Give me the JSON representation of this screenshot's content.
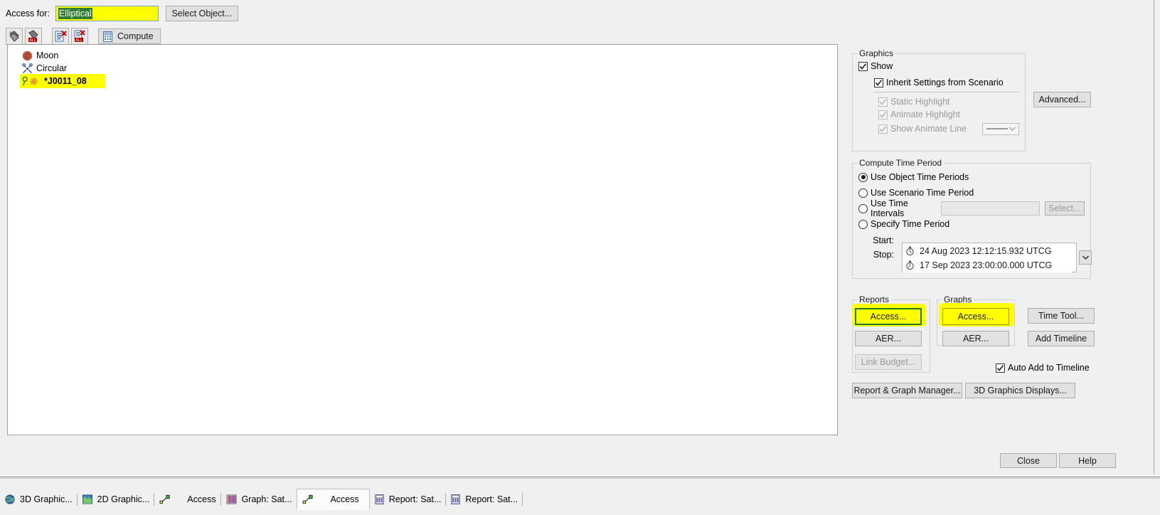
{
  "header": {
    "access_for_label": "Access for:",
    "access_for_value": "Elliptical",
    "select_object_button": "Select Object..."
  },
  "toolbar": {
    "buttons": [
      {
        "name": "remove-object",
        "label": ""
      },
      {
        "name": "remove-all-objects",
        "label": ""
      },
      {
        "name": "clear-report",
        "label": ""
      },
      {
        "name": "clear-all-reports",
        "label": ""
      }
    ],
    "compute_label": "Compute"
  },
  "object_list": {
    "items": [
      {
        "label": "Moon",
        "icon": "moon-icon",
        "selected": false
      },
      {
        "label": "Circular",
        "icon": "satellite-icon",
        "selected": false
      },
      {
        "label": "*J0011_08",
        "icon": "star-target-icon",
        "selected": true
      }
    ]
  },
  "graphics": {
    "legend": "Graphics",
    "show": {
      "label": "Show",
      "checked": true,
      "enabled": true
    },
    "inherit": {
      "label": "Inherit Settings from Scenario",
      "checked": true,
      "enabled": true
    },
    "static_highlight": {
      "label": "Static Highlight",
      "checked": true,
      "enabled": false
    },
    "animate_highlight": {
      "label": "Animate Highlight",
      "checked": true,
      "enabled": false
    },
    "show_animate_line": {
      "label": "Show Animate Line",
      "checked": true,
      "enabled": false
    },
    "advanced_button": "Advanced..."
  },
  "compute_time_period": {
    "legend": "Compute Time Period",
    "options": [
      {
        "label": "Use Object Time Periods",
        "selected": true
      },
      {
        "label": "Use Scenario Time Period",
        "selected": false
      },
      {
        "label": "Use Time Intervals",
        "selected": false
      },
      {
        "label": "Specify Time Period",
        "selected": false
      }
    ],
    "time_intervals_value": "",
    "select_button": "Select...",
    "start_label": "Start:",
    "start_value": "24 Aug 2023 12:12:15.932 UTCG",
    "stop_label": "Stop:",
    "stop_value": "17 Sep 2023 23:00:00.000 UTCG"
  },
  "reports": {
    "legend": "Reports",
    "access_button": "Access...",
    "aer_button": "AER...",
    "link_budget_button": "Link Budget..."
  },
  "graphs": {
    "legend": "Graphs",
    "access_button": "Access...",
    "aer_button": "AER..."
  },
  "tools": {
    "time_tool_button": "Time Tool...",
    "add_timeline_button": "Add Timeline",
    "auto_add_label": "Auto Add to Timeline",
    "auto_add_checked": true,
    "report_graph_manager_button": "Report & Graph Manager...",
    "graphics_displays_button": "3D Graphics Displays..."
  },
  "footer": {
    "close_button": "Close",
    "help_button": "Help"
  },
  "taskbar": {
    "items": [
      {
        "label": "3D Graphic...",
        "icon": "globe-icon",
        "active": false
      },
      {
        "label": "2D Graphic...",
        "icon": "map-icon",
        "active": false
      },
      {
        "label": "Access",
        "icon": "access-icon",
        "active": false
      },
      {
        "label": "Graph:  Sat...",
        "icon": "graph-icon",
        "active": false
      },
      {
        "label": "Access",
        "icon": "access-icon",
        "active": true
      },
      {
        "label": "Report:  Sat...",
        "icon": "report-icon",
        "active": false
      },
      {
        "label": "Report:  Sat...",
        "icon": "report-icon",
        "active": false
      }
    ]
  },
  "colors": {
    "highlight": "#ffff00",
    "selection_green": "#2e7d32",
    "annotation_green": "#1e7b1e",
    "dialog_bg": "#f0f0f0"
  }
}
